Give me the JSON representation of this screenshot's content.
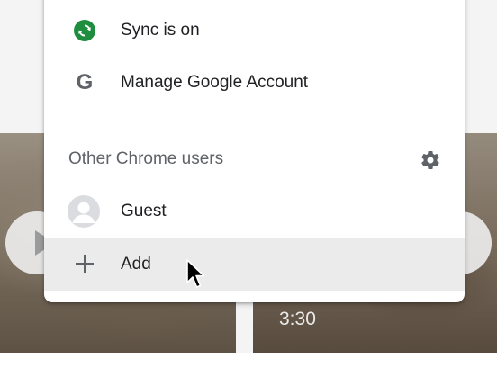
{
  "menu": {
    "sync_label": "Sync is on",
    "manage_label": "Manage Google Account",
    "other_users_label": "Other Chrome users",
    "guest_label": "Guest",
    "add_label": "Add",
    "icons": {
      "sync": "sync-icon",
      "google": "google-g-icon",
      "settings": "gear-icon",
      "guest": "avatar-icon",
      "add": "plus-icon"
    },
    "g_glyph": "G"
  },
  "background": {
    "video_duration": "3:30"
  },
  "colors": {
    "sync_green": "#1e8e3e",
    "hover_row": "#ebebeb",
    "icon_grey": "#5f6368",
    "text": "#202124"
  }
}
